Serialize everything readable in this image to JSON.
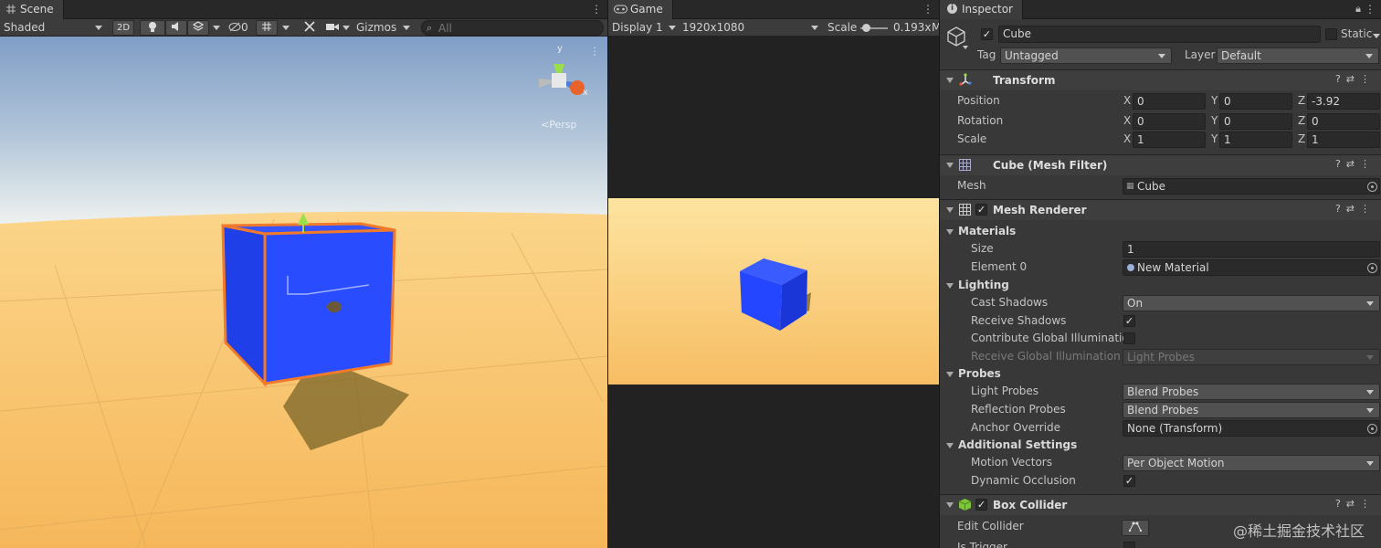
{
  "scene": {
    "tab": "Scene",
    "shading_mode": "Shaded",
    "mode_2d": "2D",
    "hidden_count": "0",
    "gizmos": "Gizmos",
    "search_placeholder": "All",
    "axis_y": "y",
    "axis_x": "x",
    "perspective": "<Persp"
  },
  "game": {
    "tab": "Game",
    "display": "Display 1",
    "resolution": "1920x1080",
    "scale_label": "Scale",
    "scale_value": "0.193x",
    "more": "M"
  },
  "inspector": {
    "tab": "Inspector",
    "object_name": "Cube",
    "static_label": "Static",
    "tag_label": "Tag",
    "tag_value": "Untagged",
    "layer_label": "Layer",
    "layer_value": "Default",
    "transform": {
      "title": "Transform",
      "position_label": "Position",
      "rotation_label": "Rotation",
      "scale_label": "Scale",
      "position": {
        "x": "0",
        "y": "0",
        "z": "-3.92"
      },
      "rotation": {
        "x": "0",
        "y": "0",
        "z": "0"
      },
      "scale": {
        "x": "1",
        "y": "1",
        "z": "1"
      },
      "x": "X",
      "y": "Y",
      "z": "Z"
    },
    "mesh_filter": {
      "title": "Cube (Mesh Filter)",
      "mesh_label": "Mesh",
      "mesh_value": "Cube"
    },
    "mesh_renderer": {
      "title": "Mesh Renderer",
      "materials": "Materials",
      "size_label": "Size",
      "size_value": "1",
      "element0_label": "Element 0",
      "element0_value": "New Material",
      "lighting": "Lighting",
      "cast_shadows_label": "Cast Shadows",
      "cast_shadows_value": "On",
      "receive_shadows_label": "Receive Shadows",
      "contribute_gi_label": "Contribute Global Illumination",
      "receive_gi_label": "Receive Global Illumination",
      "receive_gi_value": "Light Probes",
      "probes": "Probes",
      "light_probes_label": "Light Probes",
      "light_probes_value": "Blend Probes",
      "reflection_probes_label": "Reflection Probes",
      "reflection_probes_value": "Blend Probes",
      "anchor_override_label": "Anchor Override",
      "anchor_override_value": "None (Transform)",
      "additional": "Additional Settings",
      "motion_vectors_label": "Motion Vectors",
      "motion_vectors_value": "Per Object Motion",
      "dynamic_occlusion_label": "Dynamic Occlusion"
    },
    "box_collider": {
      "title": "Box Collider",
      "edit_collider_label": "Edit Collider",
      "is_trigger_label": "Is Trigger"
    }
  },
  "watermark": "@稀土掘金技术社区",
  "colors": {
    "cube": "#2a4cff",
    "selection_outline": "#f07a2a",
    "ground": "#f4c573",
    "sky_top": "#7f9dc6",
    "panel_bg": "#383838"
  }
}
